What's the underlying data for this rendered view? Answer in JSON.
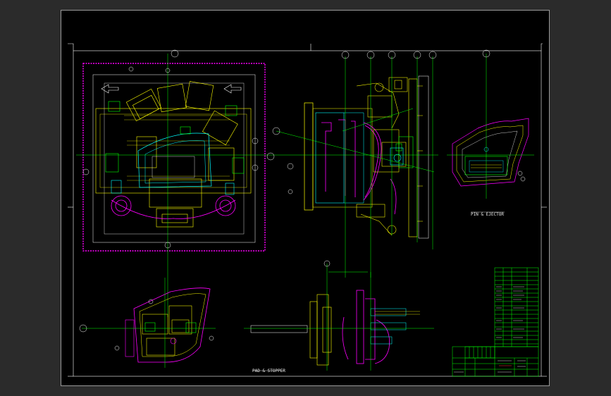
{
  "drawing": {
    "view_label_pin_ejector": "PIN & EJECTOR",
    "view_label_pad_stopper": "PAD & STOPPER"
  },
  "colors": {
    "background": "#000000",
    "viewport": "#2b2b2b",
    "border": "#ffffff",
    "centerline": "#00ff00",
    "part_yellow": "#ffff00",
    "part_magenta": "#ff00ff",
    "part_cyan": "#00ffff",
    "part_green": "#00ff00",
    "part_white": "#ffffff",
    "table_grid": "#00ff00"
  },
  "icons": [
    "balloon-callout-icon",
    "direction-arrow-icon",
    "datum-target-icon"
  ]
}
